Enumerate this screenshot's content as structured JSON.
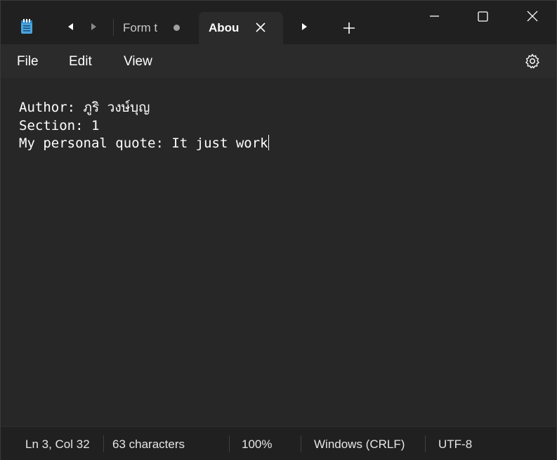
{
  "window": {
    "app_icon": "notepad-icon",
    "controls": {
      "minimize": "minimize-icon",
      "maximize": "maximize-icon",
      "close": "close-icon"
    }
  },
  "tabs": [
    {
      "label": "Form t",
      "active": false,
      "unsaved": true
    },
    {
      "label": "Abou",
      "active": true,
      "unsaved": false
    }
  ],
  "tab_controls": {
    "scroll_left_icon": "triangle-left-icon",
    "scroll_right_icon": "triangle-right-icon",
    "new_tab_icon": "plus-icon",
    "close_tab_icon": "close-icon"
  },
  "menu": {
    "file": "File",
    "edit": "Edit",
    "view": "View",
    "settings_icon": "gear-icon"
  },
  "editor": {
    "lines": [
      "Author: ภูริ วงษ์บุญ",
      "Section: 1",
      "My personal quote: It just work"
    ]
  },
  "status": {
    "position": "Ln 3, Col 32",
    "characters": "63 characters",
    "zoom": "100%",
    "line_ending": "Windows (CRLF)",
    "encoding": "UTF-8"
  },
  "colors": {
    "titlebar_bg": "#202020",
    "menubar_bg": "#2b2b2b",
    "editor_bg": "#272727",
    "text": "#ffffff",
    "icon_blue": "#4aa3df"
  }
}
